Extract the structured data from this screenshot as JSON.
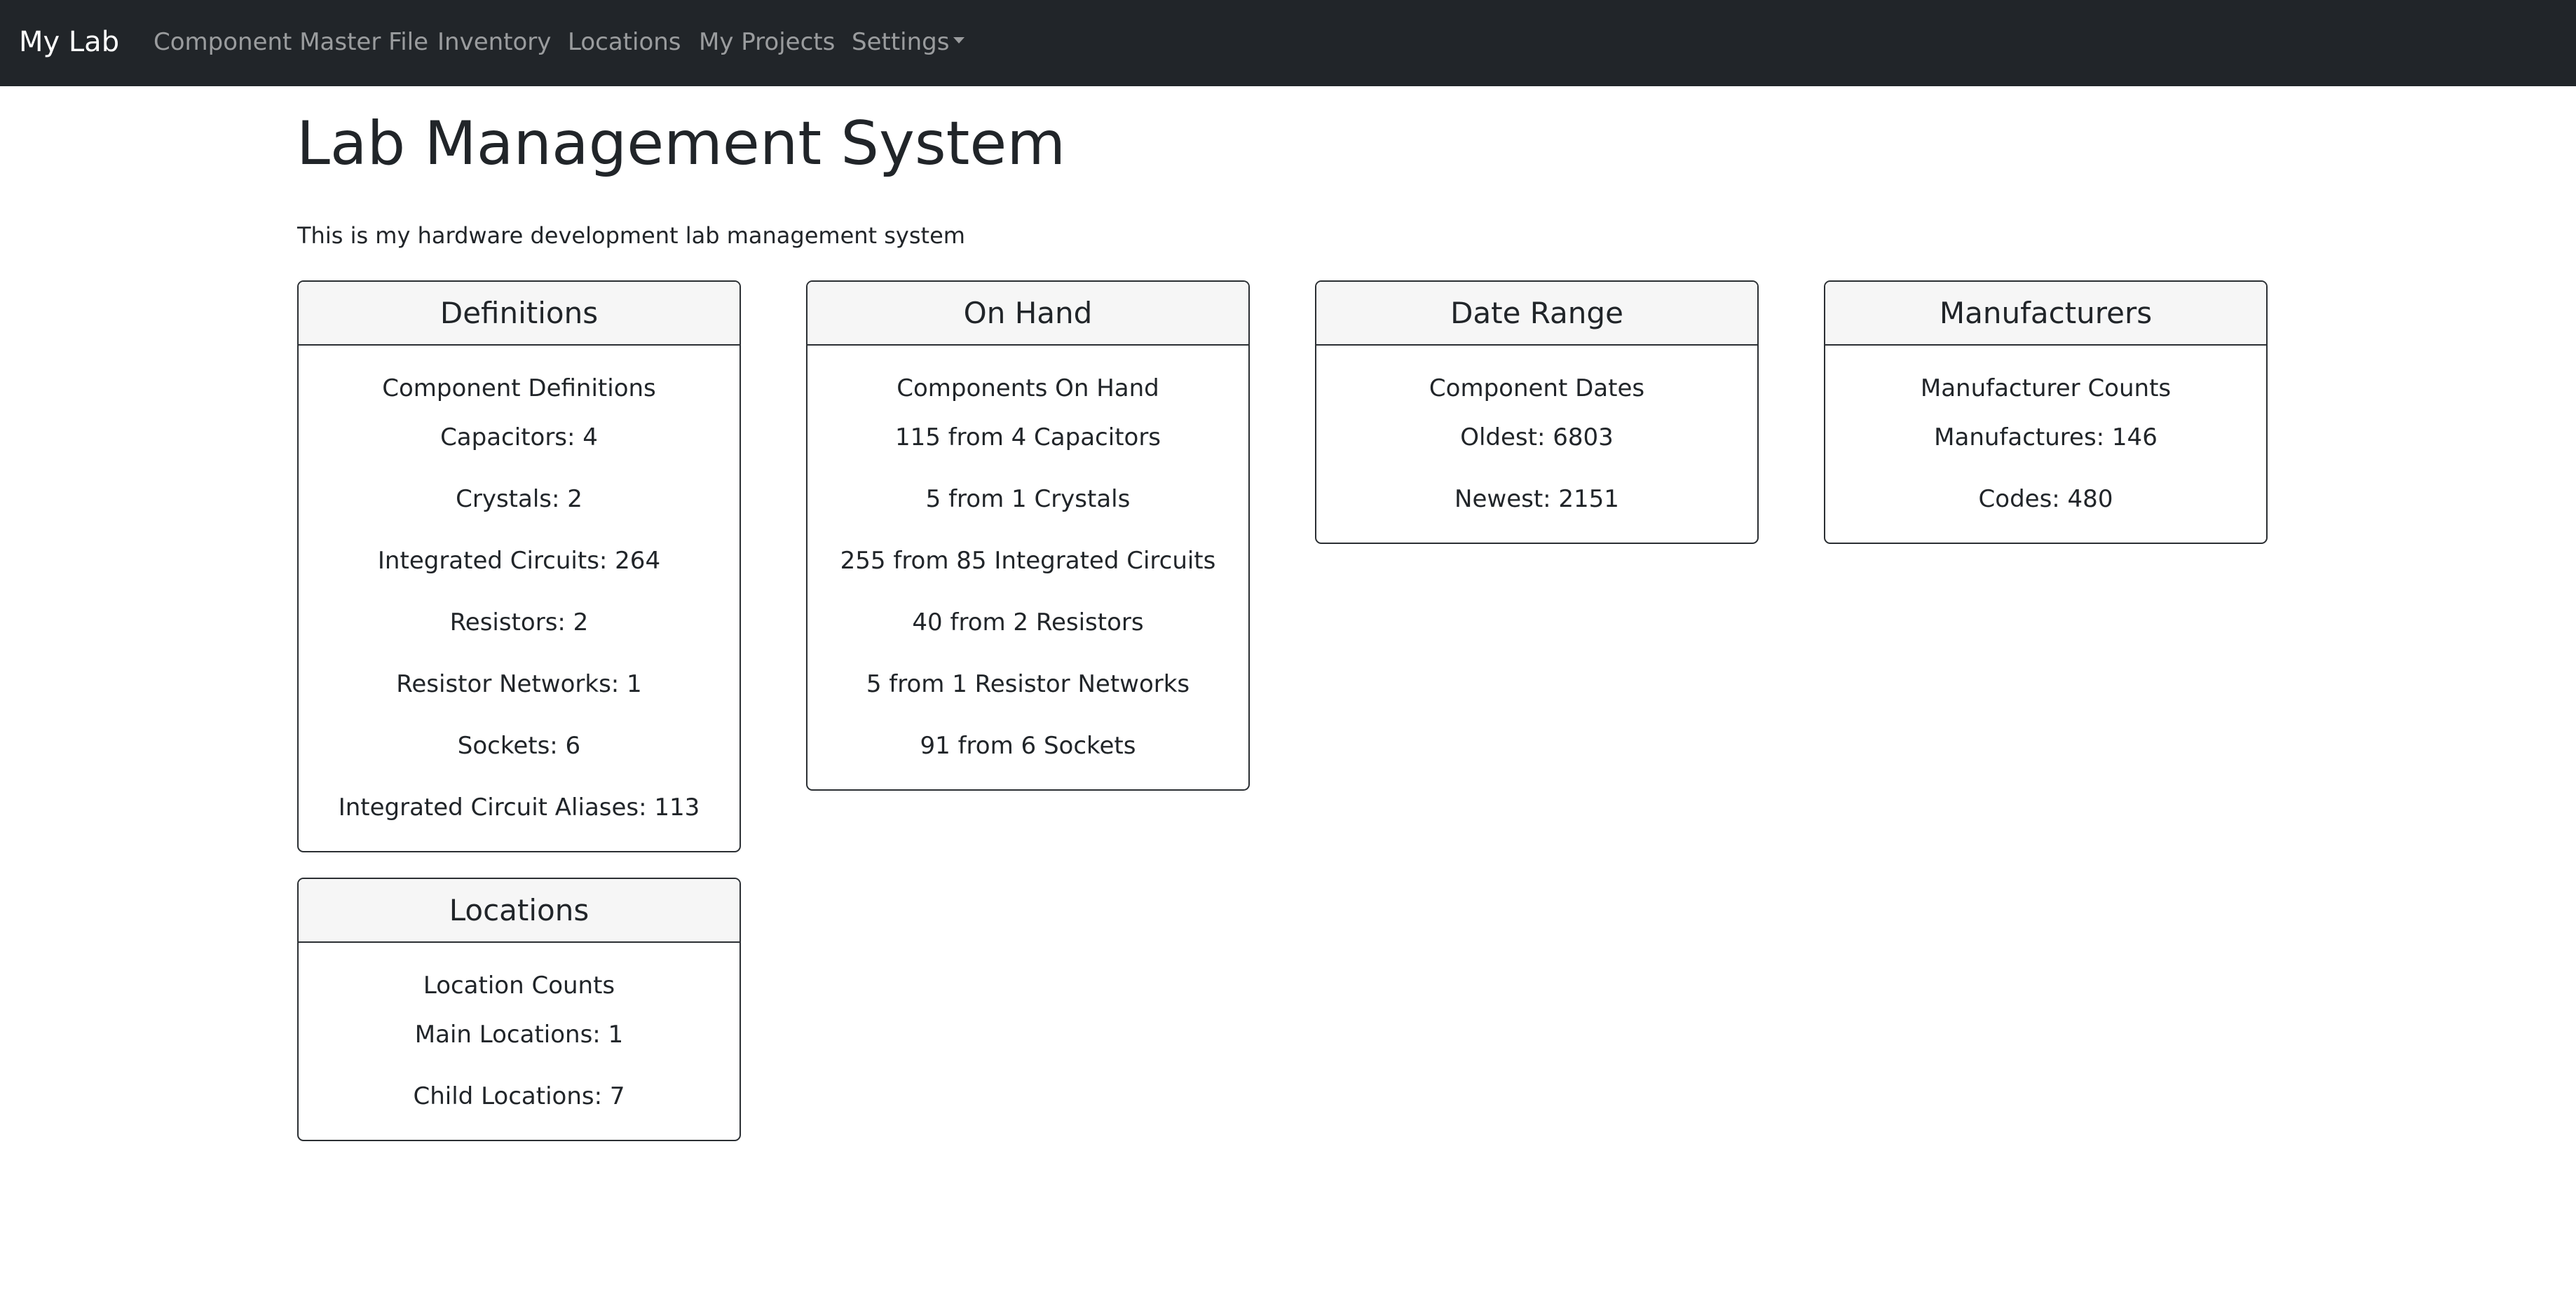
{
  "navbar": {
    "brand": "My Lab",
    "items": [
      {
        "label": "Component Master File"
      },
      {
        "label": "Inventory"
      },
      {
        "label": "Locations"
      },
      {
        "label": "My Projects"
      },
      {
        "label": "Settings"
      }
    ]
  },
  "page": {
    "title": "Lab Management System",
    "subtitle": "This is my hardware development lab management system"
  },
  "cards": {
    "definitions": {
      "header": "Definitions",
      "subtitle": "Component Definitions",
      "lines": [
        "Capacitors: 4",
        "Crystals: 2",
        "Integrated Circuits: 264",
        "Resistors: 2",
        "Resistor Networks: 1",
        "Sockets: 6",
        "Integrated Circuit Aliases: 113"
      ]
    },
    "on_hand": {
      "header": "On Hand",
      "subtitle": "Components On Hand",
      "lines": [
        "115 from 4 Capacitors",
        "5 from 1 Crystals",
        "255 from 85 Integrated Circuits",
        "40 from 2 Resistors",
        "5 from 1 Resistor Networks",
        "91 from 6 Sockets"
      ]
    },
    "date_range": {
      "header": "Date Range",
      "subtitle": "Component Dates",
      "lines": [
        "Oldest: 6803",
        "Newest: 2151"
      ]
    },
    "manufacturers": {
      "header": "Manufacturers",
      "subtitle": "Manufacturer Counts",
      "lines": [
        "Manufactures: 146",
        "Codes: 480"
      ]
    },
    "locations": {
      "header": "Locations",
      "subtitle": "Location Counts",
      "lines": [
        "Main Locations: 1",
        "Child Locations: 7"
      ]
    }
  }
}
